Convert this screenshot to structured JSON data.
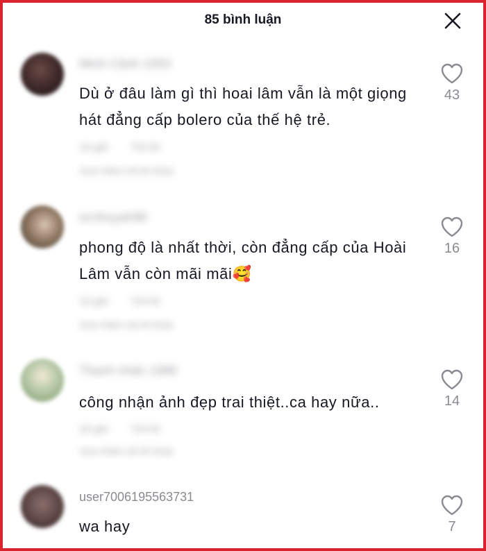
{
  "header": {
    "title": "85 bình luận"
  },
  "comments": [
    {
      "username": "Minh Cảnh 1003",
      "text": "Dù ở đâu làm gì thì hoai lâm vẫn là một giọng hát đẳng cấp bolero của thế hệ trẻ.",
      "time": "10 giờ",
      "reply": "Trả lời",
      "view_replies": "Xem thêm trả lời khác",
      "likes": "43"
    },
    {
      "username": "ecnhuyah90",
      "text": "phong độ là nhất thời, còn đẳng cấp của Hoài Lâm vẫn còn mãi mãi🥰",
      "time": "10 giờ",
      "reply": "Trả lời",
      "view_replies": "Xem thêm trả lời khác",
      "likes": "16"
    },
    {
      "username": "Thanh nhân 1996",
      "text": "công nhận ảnh đẹp trai thiệt..ca hay nữa..",
      "time": "20 giờ",
      "reply": "Trả lời",
      "view_replies": "Xem thêm trả lời khác",
      "likes": "14"
    },
    {
      "username": "user7006195563731",
      "text": "wa hay",
      "likes": "7"
    }
  ],
  "colors": {
    "frame": "#d9232d",
    "text": "#161823",
    "muted": "#8a8b91"
  }
}
